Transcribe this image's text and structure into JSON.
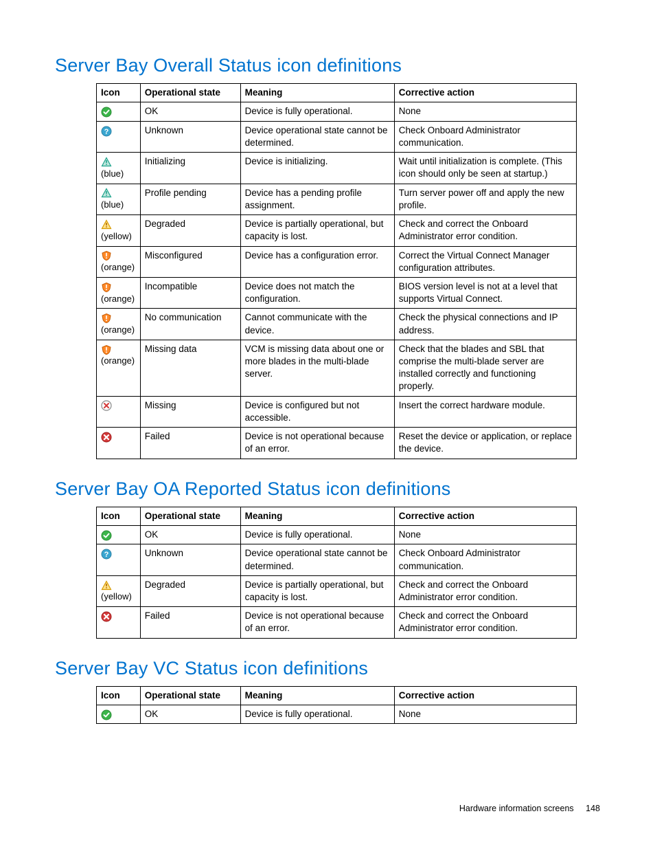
{
  "footer": {
    "section": "Hardware information screens",
    "page": "148"
  },
  "headers": [
    "Icon",
    "Operational state",
    "Meaning",
    "Corrective action"
  ],
  "sections": [
    {
      "title": "Server Bay Overall Status icon definitions",
      "rows": [
        {
          "icon": "ok",
          "note": "",
          "state": "OK",
          "meaning": "Device is fully operational.",
          "action": "None"
        },
        {
          "icon": "unknown",
          "note": "",
          "state": "Unknown",
          "meaning": "Device operational state cannot be determined.",
          "action": "Check Onboard Administrator communication."
        },
        {
          "icon": "tri-blue",
          "note": "(blue)",
          "state": "Initializing",
          "meaning": "Device is initializing.",
          "action": "Wait until initialization is complete. (This icon should only be seen at startup.)"
        },
        {
          "icon": "tri-blue",
          "note": "(blue)",
          "state": "Profile pending",
          "meaning": "Device has a pending profile assignment.",
          "action": "Turn server power off and apply the new profile."
        },
        {
          "icon": "tri-yellow",
          "note": "(yellow)",
          "state": "Degraded",
          "meaning": "Device is partially operational, but capacity is lost.",
          "action": "Check and correct the Onboard Administrator error condition."
        },
        {
          "icon": "shield-orange",
          "note": "(orange)",
          "state": "Misconfigured",
          "meaning": "Device has a configuration error.",
          "action": "Correct the Virtual Connect Manager configuration attributes."
        },
        {
          "icon": "shield-orange",
          "note": "(orange)",
          "state": "Incompatible",
          "meaning": "Device does not match the configuration.",
          "action": "BIOS version level is not at a level that supports Virtual Connect."
        },
        {
          "icon": "shield-orange",
          "note": "(orange)",
          "state": "No communication",
          "meaning": "Cannot communicate with the device.",
          "action": "Check the physical connections and IP address."
        },
        {
          "icon": "shield-orange",
          "note": "(orange)",
          "state": "Missing data",
          "meaning": "VCM is missing data about one or more blades in the multi-blade server.",
          "action": "Check that the blades and SBL that comprise the multi-blade server are installed correctly and functioning properly."
        },
        {
          "icon": "missing",
          "note": "",
          "state": "Missing",
          "meaning": "Device is configured but not accessible.",
          "action": "Insert the correct hardware module."
        },
        {
          "icon": "failed",
          "note": "",
          "state": "Failed",
          "meaning": "Device is not operational because of an error.",
          "action": "Reset the device or application, or replace the device."
        }
      ]
    },
    {
      "title": "Server Bay OA Reported Status icon definitions",
      "rows": [
        {
          "icon": "ok",
          "note": "",
          "state": "OK",
          "meaning": "Device is fully operational.",
          "action": "None"
        },
        {
          "icon": "unknown",
          "note": "",
          "state": "Unknown",
          "meaning": "Device operational state cannot be determined.",
          "action": "Check Onboard Administrator communication."
        },
        {
          "icon": "tri-yellow",
          "note": "(yellow)",
          "state": "Degraded",
          "meaning": "Device is partially operational, but capacity is lost.",
          "action": "Check and correct the Onboard Administrator error condition."
        },
        {
          "icon": "failed",
          "note": "",
          "state": "Failed",
          "meaning": "Device is not operational because of an error.",
          "action": "Check and correct the Onboard Administrator error condition."
        }
      ]
    },
    {
      "title": "Server Bay VC Status icon definitions",
      "rows": [
        {
          "icon": "ok",
          "note": "",
          "state": "OK",
          "meaning": "Device is fully operational.",
          "action": "None"
        }
      ]
    }
  ]
}
